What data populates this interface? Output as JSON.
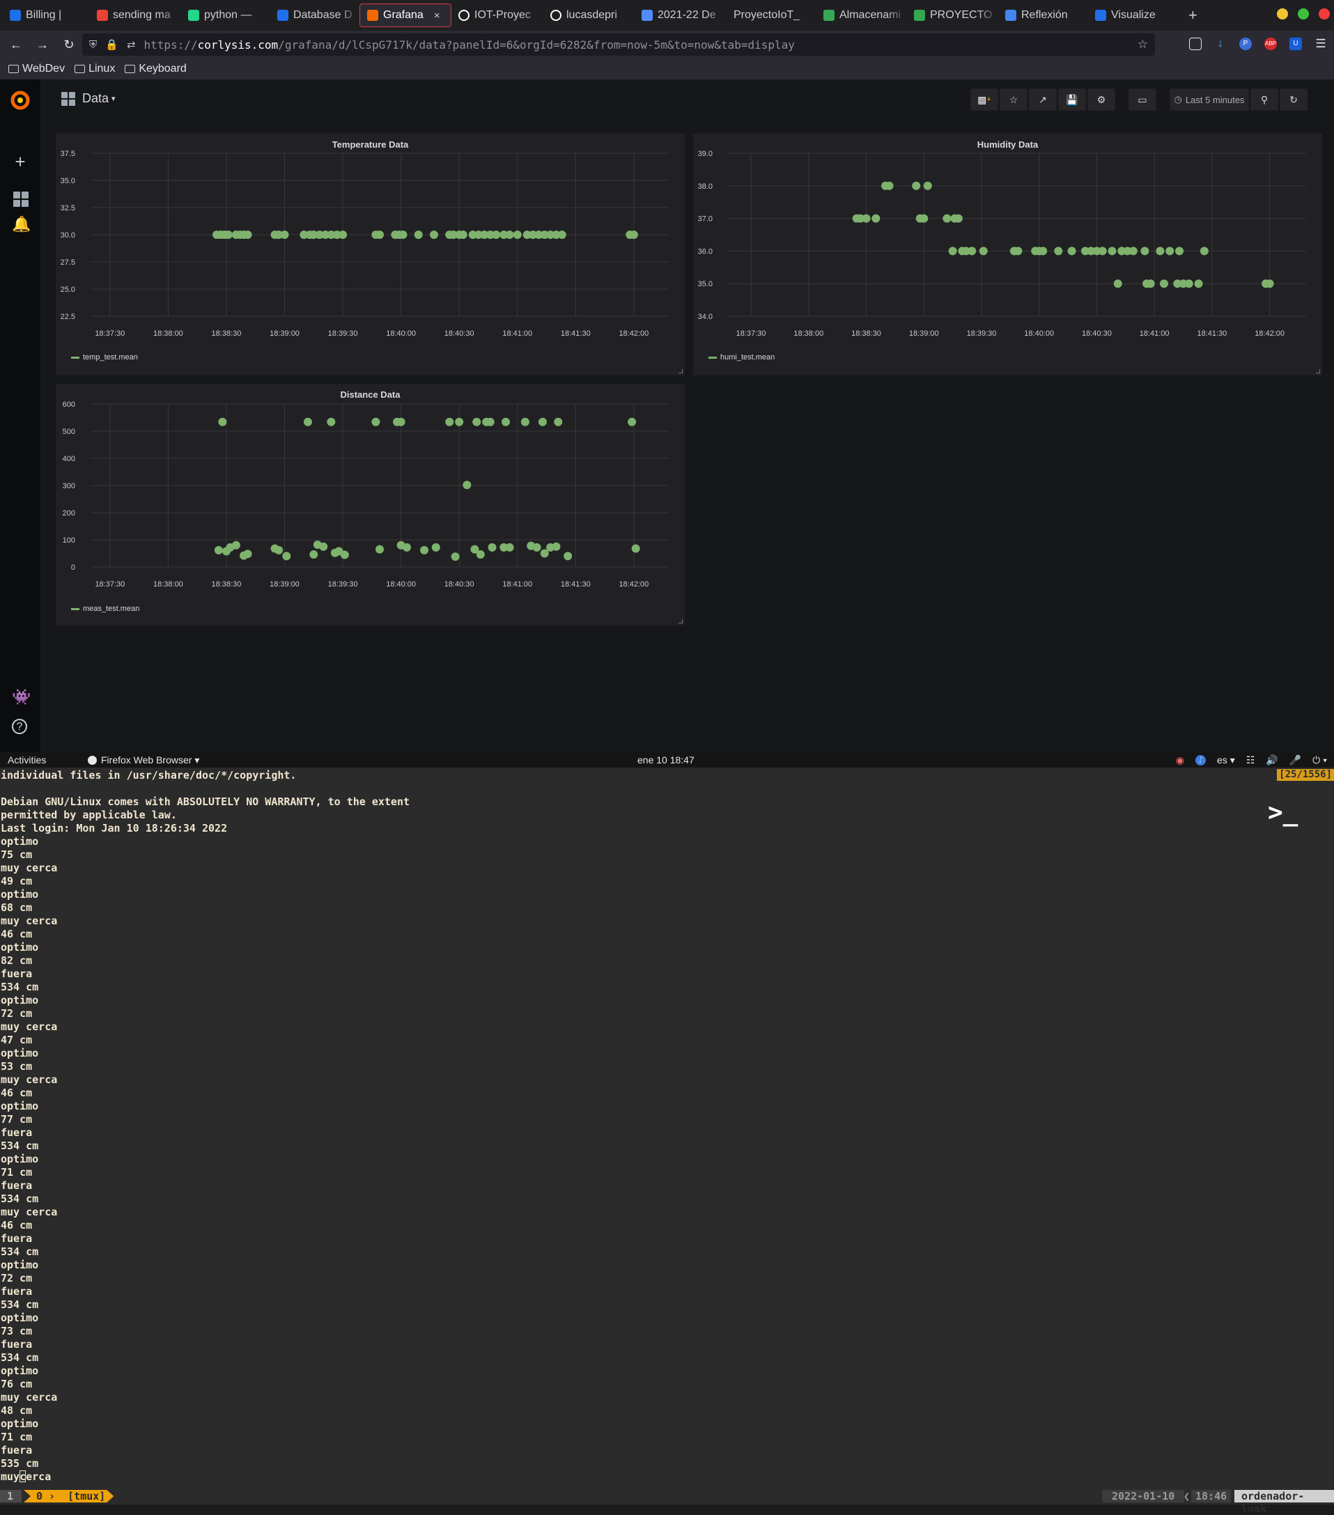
{
  "browser": {
    "tabs": [
      {
        "label": "Billing |",
        "icon": "globe-icon",
        "color": "#1f6feb"
      },
      {
        "label": "sending ma",
        "icon": "gmail-icon",
        "color": "#ea4335"
      },
      {
        "label": "python — ",
        "icon": "pycharm-icon",
        "color": "#21d789"
      },
      {
        "label": "Database D",
        "icon": "globe-icon",
        "color": "#1f6feb"
      },
      {
        "label": "Grafana",
        "icon": "grafana-icon",
        "color": "#f46800",
        "active": true
      },
      {
        "label": "IOT-Proyec",
        "icon": "github-icon",
        "color": "#ffffff"
      },
      {
        "label": "lucasdepri",
        "icon": "github-icon",
        "color": "#ffffff"
      },
      {
        "label": "2021-22 De",
        "icon": "document-icon",
        "color": "#4f8cff"
      },
      {
        "label": "ProyectoIoT_",
        "icon": "",
        "color": ""
      },
      {
        "label": "Almacenami",
        "icon": "drive-icon",
        "color": "#34a853"
      },
      {
        "label": "PROYECTO ",
        "icon": "drive-icon",
        "color": "#34a853"
      },
      {
        "label": "Reflexión",
        "icon": "docs-icon",
        "color": "#4285f4"
      },
      {
        "label": "Visualize",
        "icon": "globe-icon",
        "color": "#1f6feb"
      }
    ],
    "close_glyph": "×",
    "new_tab_glyph": "+",
    "url_prefix": "https://",
    "url_domain": "corlysis.com",
    "url_path": "/grafana/d/lCspG717k/data?panelId=6&orgId=6282&from=now-5m&to=now&tab=display",
    "bookmarks": [
      "WebDev",
      "Linux",
      "Keyboard"
    ]
  },
  "grafana": {
    "dashboard_title": "Data",
    "dashboard_caret": "▾",
    "time_range": "Last 5 minutes",
    "panels": {
      "temperature": {
        "title": "Temperature Data",
        "legend": "temp_test.mean"
      },
      "humidity": {
        "title": "Humidity Data",
        "legend": "humi_test.mean"
      },
      "distance": {
        "title": "Distance Data",
        "legend": "meas_test.mean"
      }
    },
    "series_color": "#7eb26d"
  },
  "chart_data": [
    {
      "type": "scatter",
      "title": "Temperature Data",
      "legend": "temp_test.mean",
      "x_ticks": [
        "18:37:30",
        "18:38:00",
        "18:38:30",
        "18:39:00",
        "18:39:30",
        "18:40:00",
        "18:40:30",
        "18:41:00",
        "18:41:30",
        "18:42:00"
      ],
      "y_ticks": [
        "37.5",
        "35.0",
        "32.5",
        "30.0",
        "27.5",
        "25.0",
        "22.5"
      ],
      "xlim": [
        "18:37:20",
        "18:42:18"
      ],
      "ylim": [
        22.5,
        37.5
      ],
      "grid": true,
      "x": [
        "18:38:25",
        "18:38:27",
        "18:38:29",
        "18:38:31",
        "18:38:35",
        "18:38:37",
        "18:38:39",
        "18:38:41",
        "18:38:55",
        "18:38:57",
        "18:39:00",
        "18:39:10",
        "18:39:13",
        "18:39:15",
        "18:39:18",
        "18:39:21",
        "18:39:24",
        "18:39:27",
        "18:39:30",
        "18:39:47",
        "18:39:49",
        "18:39:57",
        "18:39:59",
        "18:40:01",
        "18:40:09",
        "18:40:17",
        "18:40:25",
        "18:40:27",
        "18:40:30",
        "18:40:32",
        "18:40:37",
        "18:40:40",
        "18:40:43",
        "18:40:46",
        "18:40:49",
        "18:40:53",
        "18:40:56",
        "18:41:00",
        "18:41:05",
        "18:41:08",
        "18:41:11",
        "18:41:14",
        "18:41:17",
        "18:41:20",
        "18:41:23",
        "18:41:58",
        "18:42:00"
      ],
      "y": [
        30,
        30,
        30,
        30,
        30,
        30,
        30,
        30,
        30,
        30,
        30,
        30,
        30,
        30,
        30,
        30,
        30,
        30,
        30,
        30,
        30,
        30,
        30,
        30,
        30,
        30,
        30,
        30,
        30,
        30,
        30,
        30,
        30,
        30,
        30,
        30,
        30,
        30,
        30,
        30,
        30,
        30,
        30,
        30,
        30,
        30,
        30
      ]
    },
    {
      "type": "scatter",
      "title": "Humidity Data",
      "legend": "humi_test.mean",
      "x_ticks": [
        "18:37:30",
        "18:38:00",
        "18:38:30",
        "18:39:00",
        "18:39:30",
        "18:40:00",
        "18:40:30",
        "18:41:00",
        "18:41:30",
        "18:42:00"
      ],
      "y_ticks": [
        "39.0",
        "38.0",
        "37.0",
        "36.0",
        "35.0",
        "34.0"
      ],
      "xlim": [
        "18:37:18",
        "18:42:19"
      ],
      "ylim": [
        34,
        39
      ],
      "grid": true,
      "x": [
        "18:38:25",
        "18:38:27",
        "18:38:30",
        "18:38:35",
        "18:38:40",
        "18:38:42",
        "18:38:56",
        "18:38:58",
        "18:39:00",
        "18:39:02",
        "18:39:12",
        "18:39:16",
        "18:39:18",
        "18:39:15",
        "18:39:20",
        "18:39:22",
        "18:39:25",
        "18:39:31",
        "18:39:47",
        "18:39:49",
        "18:39:58",
        "18:40:00",
        "18:40:02",
        "18:40:10",
        "18:40:17",
        "18:40:24",
        "18:40:27",
        "18:40:30",
        "18:40:33",
        "18:40:38",
        "18:40:43",
        "18:40:46",
        "18:40:49",
        "18:40:55",
        "18:41:03",
        "18:41:08",
        "18:41:13",
        "18:41:26",
        "18:40:41",
        "18:40:56",
        "18:40:58",
        "18:41:05",
        "18:41:12",
        "18:41:15",
        "18:41:18",
        "18:41:23",
        "18:41:58",
        "18:42:00"
      ],
      "y": [
        37,
        37,
        37,
        37,
        38,
        38,
        38,
        37,
        37,
        38,
        37,
        37,
        37,
        36,
        36,
        36,
        36,
        36,
        36,
        36,
        36,
        36,
        36,
        36,
        36,
        36,
        36,
        36,
        36,
        36,
        36,
        36,
        36,
        36,
        36,
        36,
        36,
        36,
        35,
        35,
        35,
        35,
        35,
        35,
        35,
        35,
        35,
        35
      ]
    },
    {
      "type": "scatter",
      "title": "Distance Data",
      "legend": "meas_test.mean",
      "x_ticks": [
        "18:37:30",
        "18:38:00",
        "18:38:30",
        "18:39:00",
        "18:39:30",
        "18:40:00",
        "18:40:30",
        "18:41:00",
        "18:41:30",
        "18:42:00"
      ],
      "y_ticks": [
        "600",
        "500",
        "400",
        "300",
        "200",
        "100",
        "0"
      ],
      "xlim": [
        "18:37:20",
        "18:42:18"
      ],
      "ylim": [
        0,
        600
      ],
      "grid": true,
      "x": [
        "18:38:28",
        "18:39:12",
        "18:39:24",
        "18:39:47",
        "18:39:58",
        "18:40:00",
        "18:40:25",
        "18:40:30",
        "18:40:39",
        "18:40:44",
        "18:40:46",
        "18:40:54",
        "18:41:04",
        "18:41:13",
        "18:41:21",
        "18:41:59",
        "18:40:34",
        "18:38:26",
        "18:38:30",
        "18:38:32",
        "18:38:35",
        "18:38:39",
        "18:38:41",
        "18:38:55",
        "18:38:57",
        "18:39:01",
        "18:39:15",
        "18:39:17",
        "18:39:20",
        "18:39:26",
        "18:39:28",
        "18:39:31",
        "18:39:49",
        "18:40:00",
        "18:40:03",
        "18:40:12",
        "18:40:18",
        "18:40:28",
        "18:40:38",
        "18:40:41",
        "18:40:47",
        "18:40:53",
        "18:40:56",
        "18:41:07",
        "18:41:10",
        "18:41:14",
        "18:41:17",
        "18:41:20",
        "18:41:26",
        "18:42:01"
      ],
      "y": [
        534,
        534,
        534,
        534,
        534,
        534,
        534,
        534,
        534,
        534,
        534,
        534,
        534,
        534,
        534,
        534,
        302,
        62,
        58,
        72,
        80,
        42,
        48,
        68,
        62,
        40,
        46,
        82,
        75,
        52,
        58,
        45,
        65,
        80,
        72,
        62,
        72,
        38,
        65,
        46,
        72,
        72,
        72,
        78,
        72,
        50,
        72,
        75,
        40,
        68
      ]
    }
  ],
  "gnome": {
    "activities": "Activities",
    "app_name": "Firefox Web Browser ▾",
    "clock": "ene 10 18:47",
    "lang": "es ▾"
  },
  "terminal": {
    "counter": "[25/1556]",
    "lines": [
      "individual files in /usr/share/doc/*/copyright.",
      "",
      "Debian GNU/Linux comes with ABSOLUTELY NO WARRANTY, to the extent",
      "permitted by applicable law.",
      "Last login: Mon Jan 10 18:26:34 2022",
      "optimo",
      "75 cm",
      "muy cerca",
      "49 cm",
      "optimo",
      "68 cm",
      "muy cerca",
      "46 cm",
      "optimo",
      "82 cm",
      "fuera",
      "534 cm",
      "optimo",
      "72 cm",
      "muy cerca",
      "47 cm",
      "optimo",
      "53 cm",
      "muy cerca",
      "46 cm",
      "optimo",
      "77 cm",
      "fuera",
      "534 cm",
      "optimo",
      "71 cm",
      "fuera",
      "534 cm",
      "muy cerca",
      "46 cm",
      "fuera",
      "534 cm",
      "optimo",
      "72 cm",
      "fuera",
      "534 cm",
      "optimo",
      "73 cm",
      "fuera",
      "534 cm",
      "optimo",
      "76 cm",
      "muy cerca",
      "48 cm",
      "optimo",
      "71 cm",
      "fuera",
      "535 cm"
    ],
    "last_line_before": "muy",
    "last_line_after": "cerca",
    "prompt_glyph": ">_"
  },
  "tmux": {
    "window_index": "1",
    "pane": "0",
    "session": "[tmux]",
    "date": "2022-01-10",
    "time": "18:46",
    "host": "ordenador-luak"
  }
}
